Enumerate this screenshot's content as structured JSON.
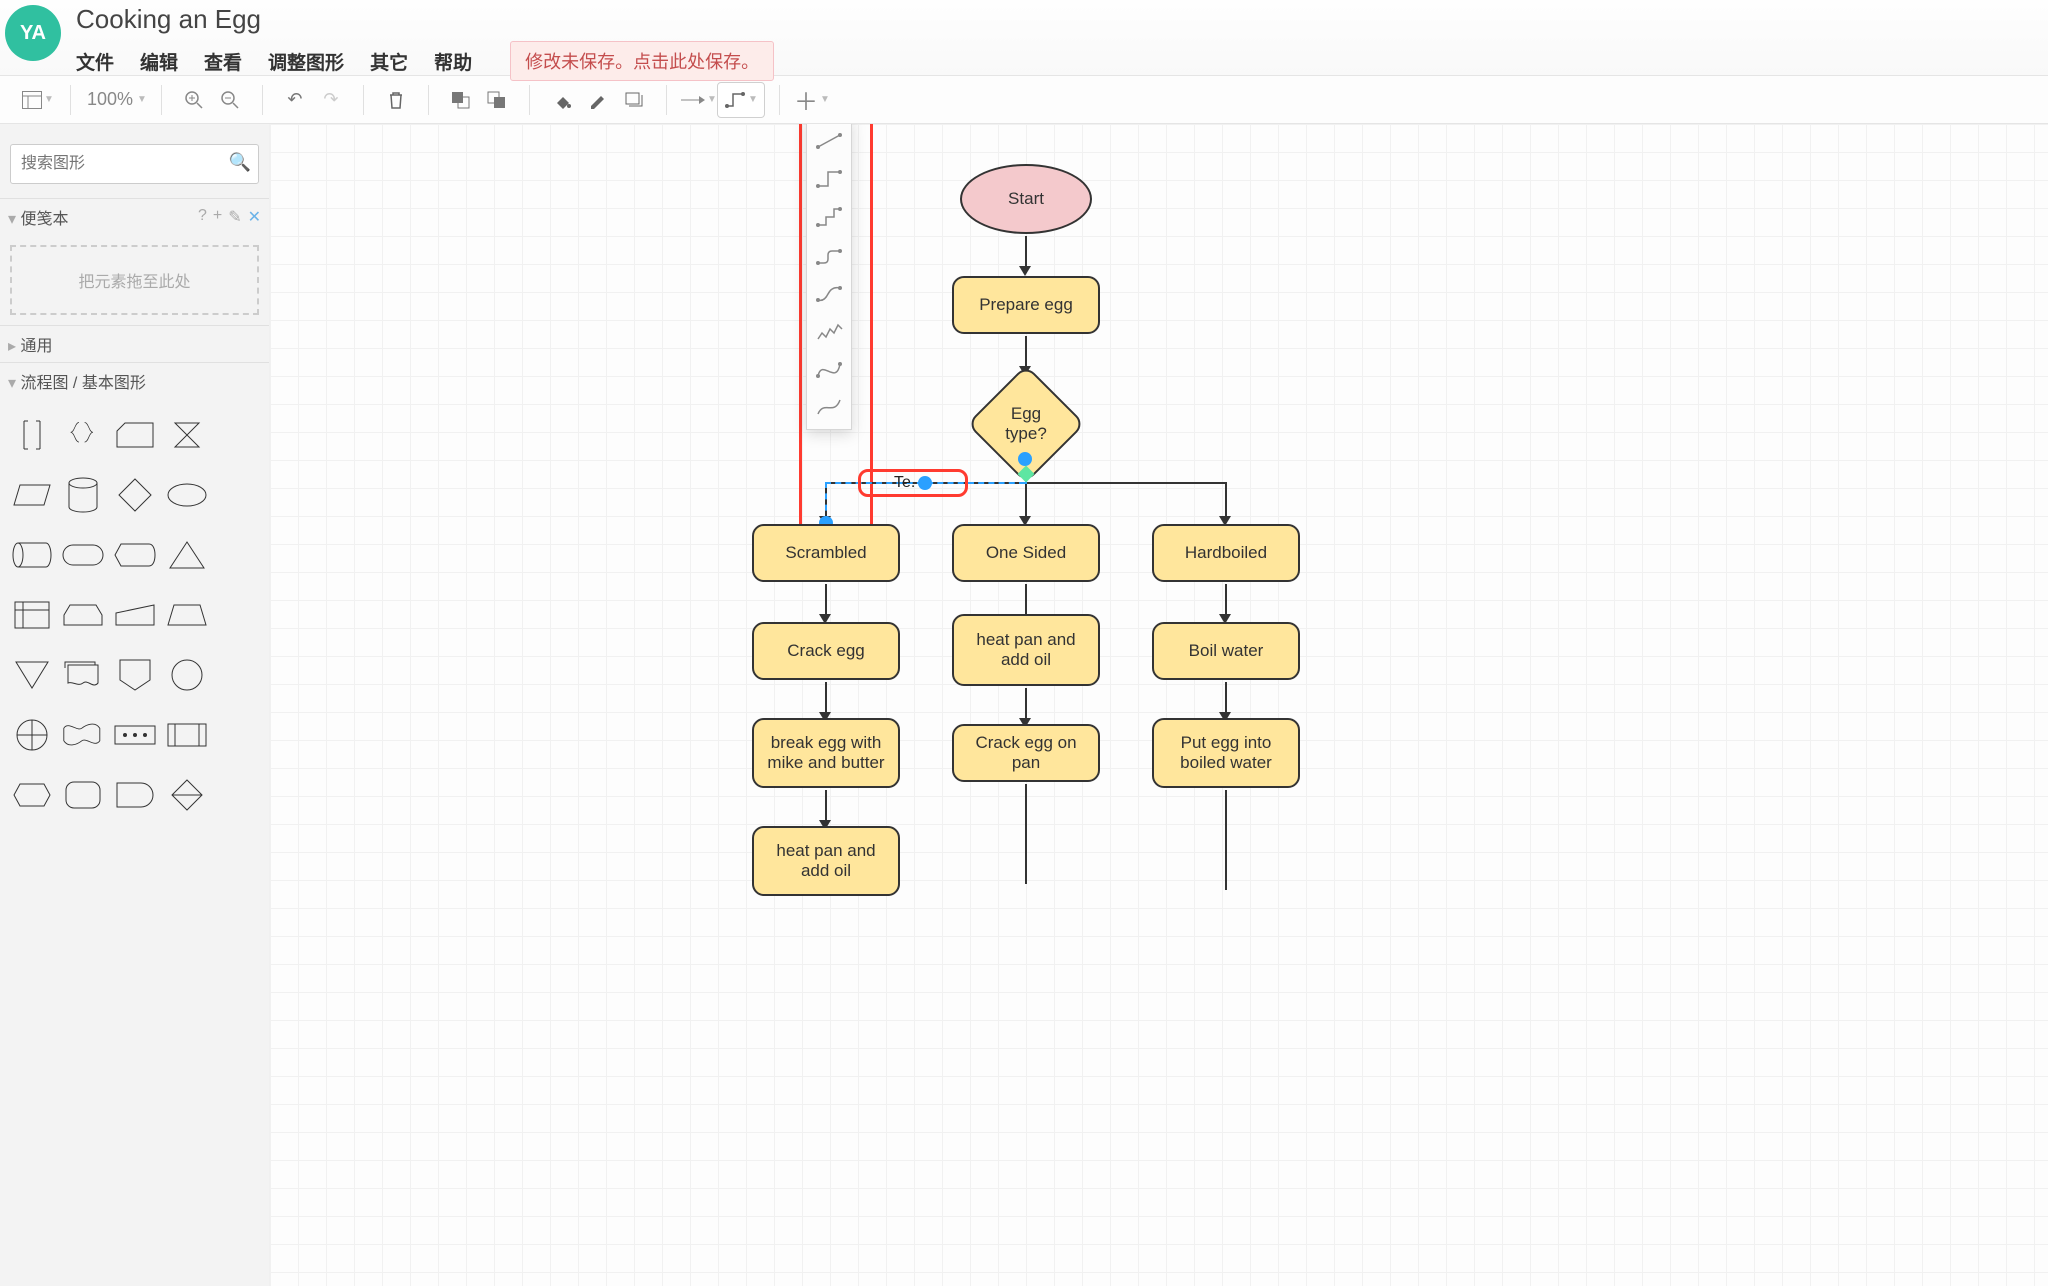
{
  "avatar": "YA",
  "title": "Cooking an Egg",
  "menu": {
    "file": "文件",
    "edit": "编辑",
    "view": "查看",
    "arrange": "调整图形",
    "extras": "其它",
    "help": "帮助"
  },
  "save_warning": "修改未保存。点击此处保存。",
  "zoom": "100%",
  "sidebar": {
    "search_placeholder": "搜索图形",
    "scratchpad_title": "便笺本",
    "scratchpad_drop": "把元素拖至此处",
    "section_general": "通用",
    "section_flowchart": "流程图 / 基本图形"
  },
  "waypoint_options": [
    "straight",
    "orthogonal",
    "orthogonal-split",
    "orthogonal-rounded",
    "spline",
    "jagged",
    "curved",
    "smooth-curve"
  ],
  "selected_edge_label": "Te.",
  "flow": {
    "start": "Start",
    "prepare": "Prepare egg",
    "decision": "Egg type?",
    "col1": {
      "a": "Scrambled",
      "b": "Crack egg",
      "c": "break egg with mike and butter",
      "d": "heat pan and add oil"
    },
    "col2": {
      "a": "One Sided",
      "b": "heat pan and add oil",
      "c": "Crack egg on pan"
    },
    "col3": {
      "a": "Hardboiled",
      "b": "Boil water",
      "c": "Put egg into boiled water"
    }
  }
}
